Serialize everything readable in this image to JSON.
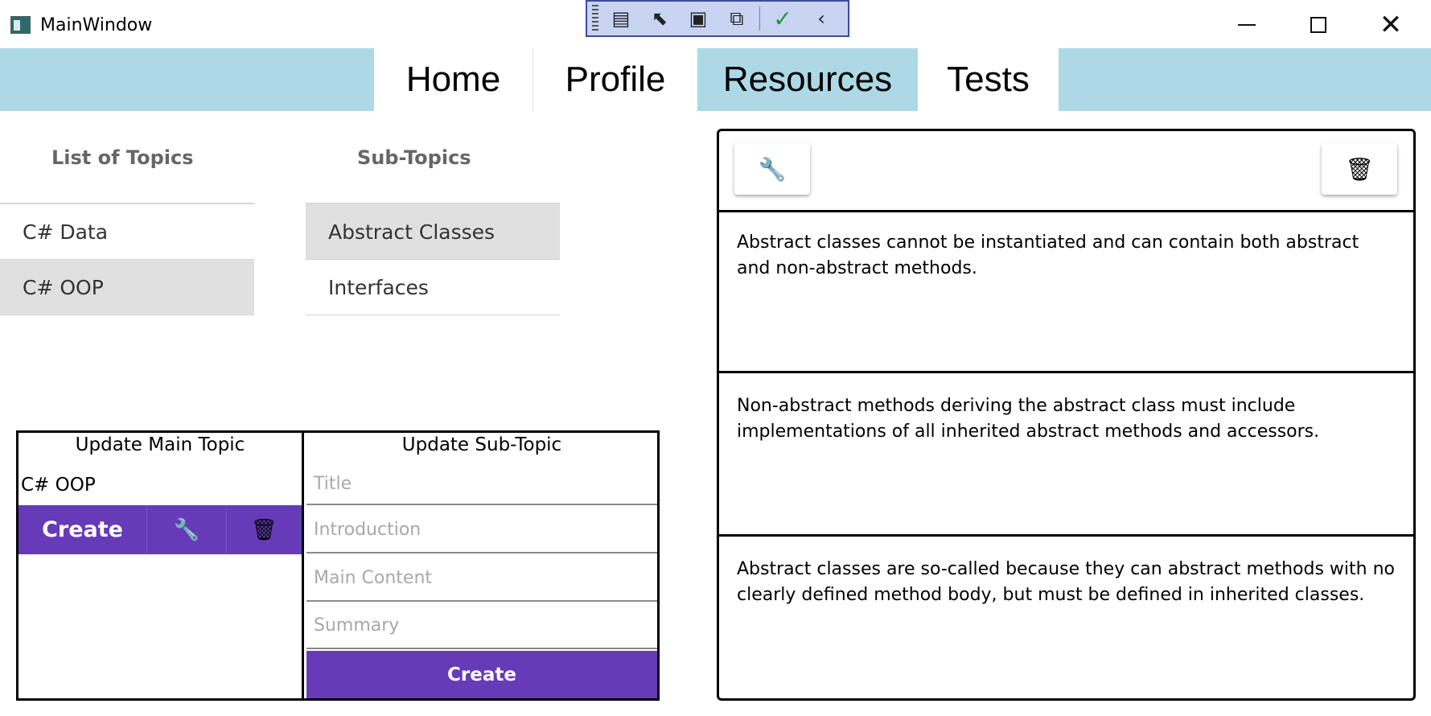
{
  "window": {
    "title": "MainWindow",
    "controls": {
      "minimize": "—",
      "maximize": "☐",
      "close": "✕"
    }
  },
  "nav": {
    "tabs": [
      {
        "label": "Home"
      },
      {
        "label": "Profile"
      },
      {
        "label": "Resources"
      },
      {
        "label": "Tests"
      }
    ],
    "active_tab": "Resources",
    "bar_color": "#add8e6"
  },
  "topics": {
    "heading": "List of Topics",
    "items": [
      {
        "label": "C# Data"
      },
      {
        "label": "C# OOP"
      }
    ],
    "selected": "C# OOP"
  },
  "subtopics": {
    "heading": "Sub-Topics",
    "items": [
      {
        "label": "Abstract Classes"
      },
      {
        "label": "Interfaces"
      }
    ],
    "selected": "Abstract Classes"
  },
  "update_main": {
    "heading": "Update Main Topic",
    "value": "C# OOP",
    "create_label": "Create",
    "edit_icon": "wrench-icon",
    "delete_icon": "trash-icon",
    "accent_color": "#673ab7"
  },
  "update_sub": {
    "heading": "Update Sub-Topic",
    "placeholders": {
      "title": "Title",
      "introduction": "Introduction",
      "main_content": "Main Content",
      "summary": "Summary"
    },
    "create_label": "Create"
  },
  "detail": {
    "edit_icon": "wrench-icon",
    "delete_icon": "trash-icon",
    "paragraphs": [
      "Abstract classes cannot be instantiated and can contain both abstract and non-abstract methods.",
      "Non-abstract methods deriving the abstract class must include implementations of all inherited abstract methods and accessors.",
      "Abstract classes are so-called because they can abstract methods with no clearly defined method body, but must be defined in inherited classes."
    ]
  }
}
